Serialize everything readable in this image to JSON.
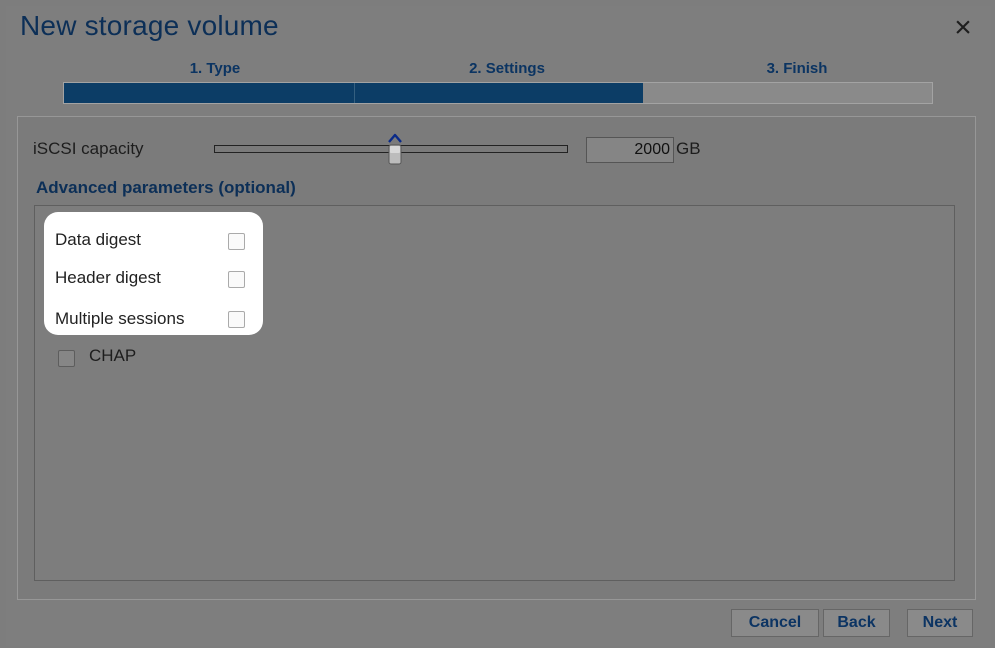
{
  "dialog": {
    "title": "New storage volume"
  },
  "steps": [
    {
      "label": "1. Type"
    },
    {
      "label": "2. Settings"
    },
    {
      "label": "3. Finish"
    }
  ],
  "progress": {
    "completed_steps": 2,
    "total_steps": 3
  },
  "capacity": {
    "label": "iSCSI capacity",
    "value": "2000",
    "unit": "GB"
  },
  "advanced": {
    "title": "Advanced parameters (optional)",
    "options": [
      {
        "label": "Data digest",
        "checked": false
      },
      {
        "label": "Header digest",
        "checked": false
      },
      {
        "label": "Multiple sessions",
        "checked": false
      }
    ],
    "chap": {
      "label": "CHAP",
      "checked": false
    }
  },
  "buttons": {
    "cancel": "Cancel",
    "back": "Back",
    "next": "Next"
  },
  "icons": {
    "close": "close-icon",
    "slider_thumb": "slider-thumb-icon"
  },
  "colors": {
    "accent": "#0c3d66",
    "title": "#0c2f57"
  }
}
